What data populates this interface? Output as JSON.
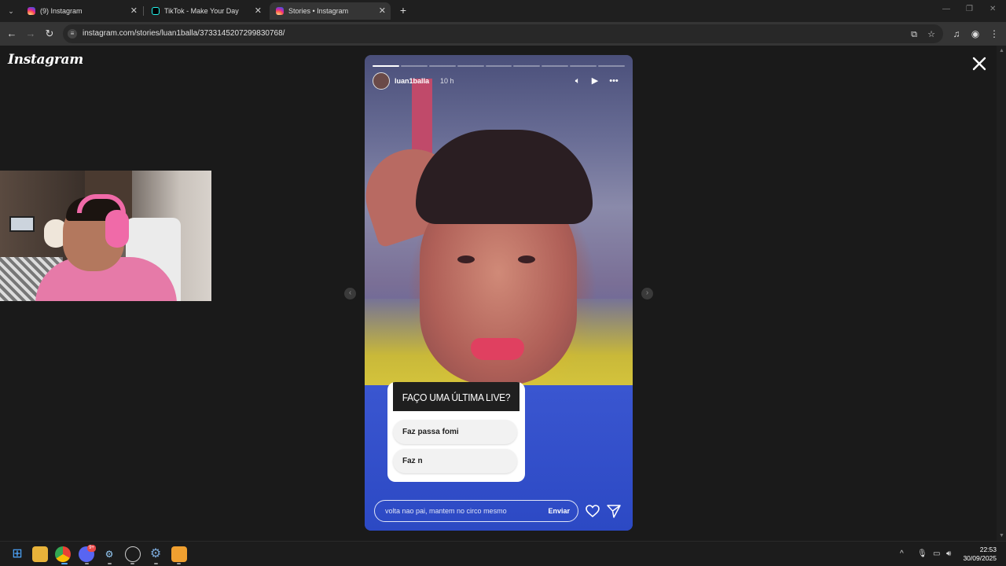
{
  "browser": {
    "tabs": [
      {
        "title": "(9) Instagram",
        "favicon": "instagram-icon",
        "active": false
      },
      {
        "title": "TikTok - Make Your Day",
        "favicon": "tiktok-icon",
        "active": false
      },
      {
        "title": "Stories • Instagram",
        "favicon": "instagram-icon",
        "active": true
      }
    ],
    "url": "instagram.com/stories/luan1balla/3733145207299830768/"
  },
  "page": {
    "logo_text": "Instagram"
  },
  "story": {
    "progress": [
      1,
      0,
      0,
      0,
      0,
      0,
      0,
      0,
      0
    ],
    "username": "luan1balla",
    "time": "10 h",
    "poll": {
      "question": "FAÇO UMA ÚLTIMA LIVE?",
      "options": [
        "Faz passa fomi",
        "Faz n"
      ]
    },
    "reply": {
      "value": "volta nao pai, mantem no circo mesmo",
      "send_label": "Enviar"
    }
  },
  "taskbar": {
    "discord_badge": "9+",
    "time": "22:53",
    "date": "30/09/2025"
  }
}
